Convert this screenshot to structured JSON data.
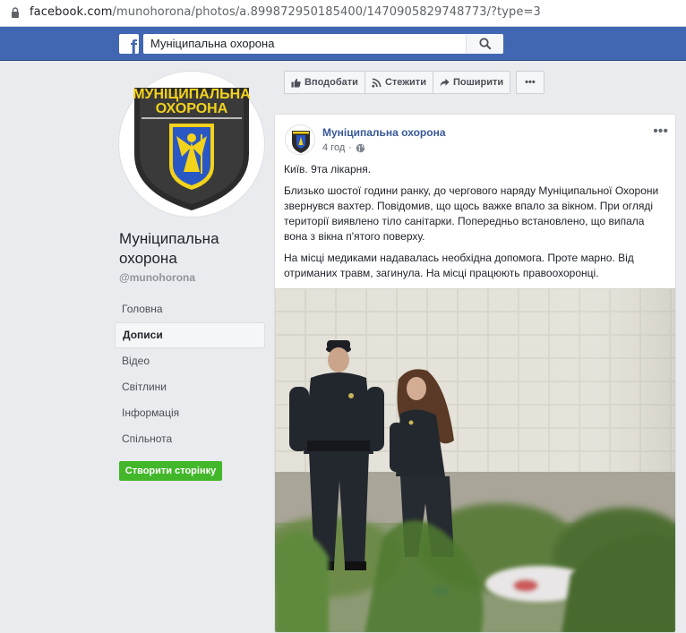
{
  "browser": {
    "url_host": "facebook.com",
    "url_path": "/munohorona/photos/a.899872950185400/1470905829748773/?type=3"
  },
  "fb": {
    "search_value": "Муніципальна охорона"
  },
  "page": {
    "avatar_text_line1": "МУНІЦИПАЛЬНА",
    "avatar_text_line2": "ОХОРОНА",
    "name": "Муніципальна охорона",
    "handle": "@munohorona",
    "nav": [
      {
        "label": "Головна",
        "active": false
      },
      {
        "label": "Дописи",
        "active": true
      },
      {
        "label": "Відео",
        "active": false
      },
      {
        "label": "Світлини",
        "active": false
      },
      {
        "label": "Інформація",
        "active": false
      },
      {
        "label": "Спільнота",
        "active": false
      }
    ],
    "create_button": "Створити сторінку"
  },
  "actions": {
    "like": "Вподобати",
    "follow": "Стежити",
    "share": "Поширити",
    "more": "•••"
  },
  "post": {
    "author": "Муніципальна охорона",
    "time": "4 год",
    "more": "•••",
    "paragraphs": [
      "Київ. 9та лікарня.",
      "Близько шостої години ранку, до чергового наряду Муніципальної Охорони звернувся вахтер. Повідомив, що щось важке впало за вікном. При огляді території виявлено тіло санітарки. Попередньо встановлено, що випала вона з вікна п'ятого поверху.",
      "На місці медиками надавалась необхідна допомога. Проте марно. Від отриманих травм, загинула. На місці працюють правоохоронці."
    ]
  },
  "colors": {
    "fb_blue": "#4267b2",
    "link_blue": "#385898",
    "green": "#42b72a",
    "bg": "#e9ebee"
  }
}
